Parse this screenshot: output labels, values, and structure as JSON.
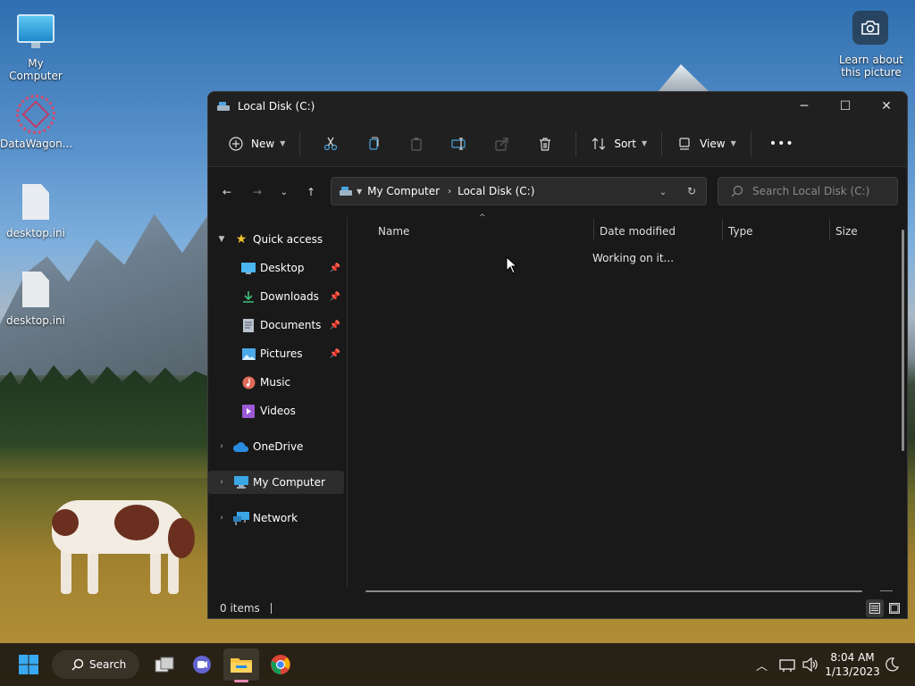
{
  "desktop": {
    "icons": [
      {
        "label": "My Computer"
      },
      {
        "label": "DataWagon..."
      },
      {
        "label": "desktop.ini"
      },
      {
        "label": "desktop.ini"
      }
    ],
    "spotlight": {
      "label": "Learn about this picture",
      "icon": "camera-icon"
    }
  },
  "window": {
    "title": "Local Disk (C:)",
    "controls": {
      "minimize": "─",
      "maximize": "☐",
      "close": "✕"
    }
  },
  "command_bar": {
    "new_label": "New",
    "sort_label": "Sort",
    "view_label": "View",
    "more_label": "•••",
    "icons": [
      "cut-icon",
      "copy-icon",
      "paste-icon",
      "rename-icon",
      "share-icon",
      "delete-icon"
    ]
  },
  "address": {
    "crumbs": [
      "My Computer",
      "Local Disk (C:)"
    ]
  },
  "search": {
    "placeholder": "Search Local Disk (C:)"
  },
  "nav_pane": {
    "quick_access": "Quick access",
    "items": [
      {
        "label": "Desktop",
        "pinned": true,
        "color": "#4cb6f0"
      },
      {
        "label": "Downloads",
        "pinned": true,
        "color": "#3fbf7a"
      },
      {
        "label": "Documents",
        "pinned": true,
        "color": "#b9c4cf"
      },
      {
        "label": "Pictures",
        "pinned": true,
        "color": "#4aa7e8"
      },
      {
        "label": "Music",
        "pinned": false,
        "color": "#e06a5a"
      },
      {
        "label": "Videos",
        "pinned": false,
        "color": "#9b59d6"
      }
    ],
    "onedrive": "OneDrive",
    "my_computer": "My Computer",
    "network": "Network"
  },
  "columns": [
    "Name",
    "Date modified",
    "Type",
    "Size"
  ],
  "content": {
    "status_message": "Working on it..."
  },
  "status_bar": {
    "items": "0 items"
  },
  "taskbar": {
    "search_label": "Search",
    "clock_time": "8:04 AM",
    "clock_date": "1/13/2023"
  },
  "colors": {
    "accent": "#0078d4",
    "window_bg": "#191919",
    "chrome_bg": "#202020"
  }
}
